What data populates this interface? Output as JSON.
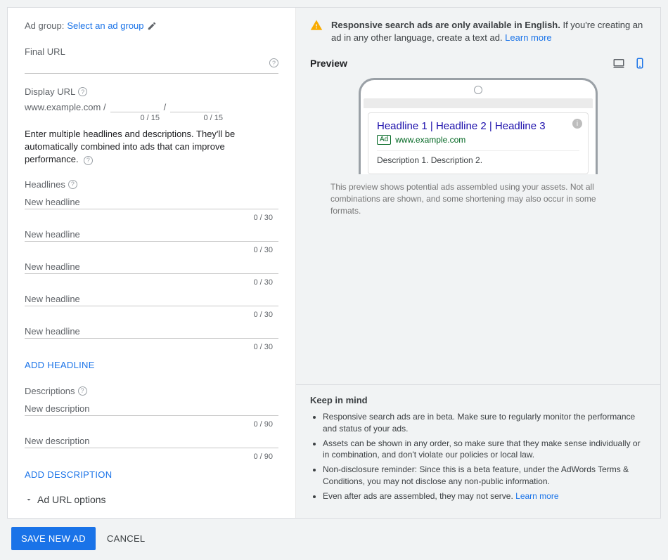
{
  "adGroup": {
    "label": "Ad group:",
    "link": "Select an ad group"
  },
  "finalUrl": {
    "label": "Final URL"
  },
  "displayUrl": {
    "label": "Display URL",
    "domain": "www.example.com /",
    "slash": "/",
    "counter1": "0 / 15",
    "counter2": "0 / 15"
  },
  "instructions": "Enter multiple headlines and descriptions. They'll be automatically combined into ads that can improve performance.",
  "headlines": {
    "label": "Headlines",
    "items": [
      {
        "placeholder": "New headline",
        "counter": "0 / 30"
      },
      {
        "placeholder": "New headline",
        "counter": "0 / 30"
      },
      {
        "placeholder": "New headline",
        "counter": "0 / 30"
      },
      {
        "placeholder": "New headline",
        "counter": "0 / 30"
      },
      {
        "placeholder": "New headline",
        "counter": "0 / 30"
      }
    ],
    "addLabel": "ADD HEADLINE"
  },
  "descriptions": {
    "label": "Descriptions",
    "items": [
      {
        "placeholder": "New description",
        "counter": "0 / 90"
      },
      {
        "placeholder": "New description",
        "counter": "0 / 90"
      }
    ],
    "addLabel": "ADD DESCRIPTION"
  },
  "urlOptions": "Ad URL options",
  "warning": {
    "bold": "Responsive search ads are only available in English.",
    "rest": " If you're creating an ad in any other language, create a text ad. ",
    "learn": "Learn more"
  },
  "preview": {
    "title": "Preview",
    "adHeadlines": "Headline 1 | Headline 2 | Headline 3",
    "adBadge": "Ad",
    "adUrl": "www.example.com",
    "adDescription": "Description 1. Description 2.",
    "note": "This preview shows potential ads assembled using your assets. Not all combinations are shown, and some shortening may also occur in some formats."
  },
  "keepInMind": {
    "title": "Keep in mind",
    "b1": "Responsive search ads are in beta. Make sure to regularly monitor the performance and status of your ads.",
    "b2": "Assets can be shown in any order, so make sure that they make sense individually or in combination, and don't violate our policies or local law.",
    "b3": "Non-disclosure reminder: Since this is a beta feature, under the AdWords Terms & Conditions, you may not disclose any non-public information.",
    "b4a": "Even after ads are assembled, they may not serve. ",
    "b4link": "Learn more"
  },
  "footer": {
    "save": "SAVE NEW AD",
    "cancel": "CANCEL"
  }
}
